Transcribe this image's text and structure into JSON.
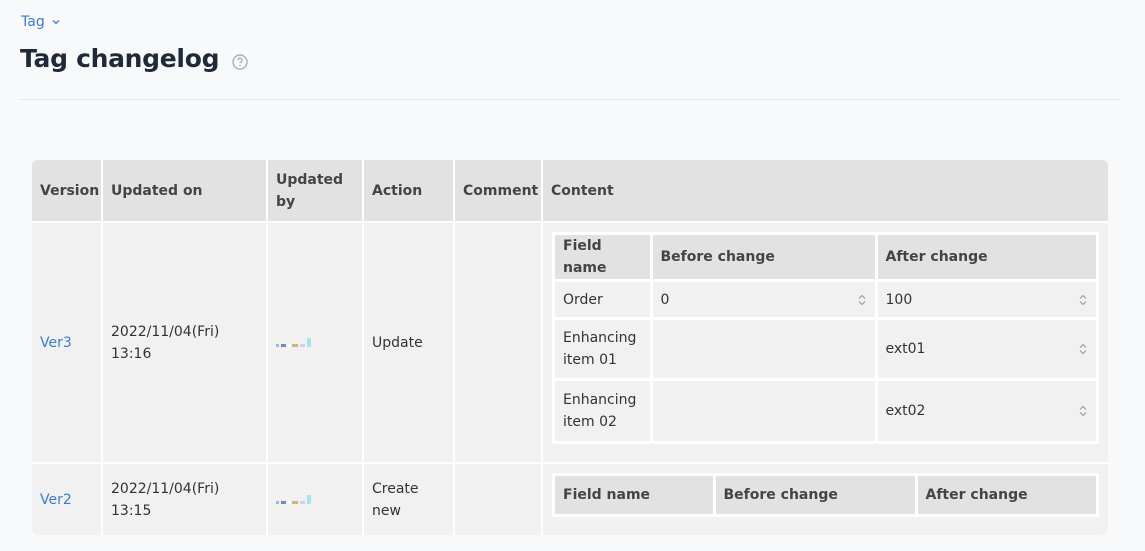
{
  "breadcrumb": {
    "label": "Tag"
  },
  "page": {
    "title": "Tag changelog"
  },
  "table": {
    "headers": {
      "version": "Version",
      "updated_on": "Updated on",
      "updated_by": "Updated by",
      "action": "Action",
      "comment": "Comment",
      "content": "Content"
    },
    "rows": [
      {
        "version": "Ver3",
        "date": "2022/11/04(Fri)",
        "time": "13:16",
        "action": "Update",
        "comment": "",
        "content": {
          "headers": {
            "field": "Field name",
            "before": "Before change",
            "after": "After change"
          },
          "rows": [
            {
              "field": "Order",
              "before": "0",
              "after": "100"
            },
            {
              "field_line1": "Enhancing",
              "field_line2": "item 01",
              "before": "",
              "after": "ext01"
            },
            {
              "field_line1": "Enhancing",
              "field_line2": "item 02",
              "before": "",
              "after": "ext02"
            }
          ]
        }
      },
      {
        "version": "Ver2",
        "date": "2022/11/04(Fri)",
        "time": "13:15",
        "action_line1": "Create",
        "action_line2": "new",
        "comment": "",
        "content": {
          "headers": {
            "field": "Field name",
            "before": "Before change",
            "after": "After change"
          }
        }
      }
    ]
  },
  "colors": {
    "accent": "#3a7bd5",
    "header_bg": "#e2e2e2",
    "cell_bg": "#f1f1f1"
  }
}
